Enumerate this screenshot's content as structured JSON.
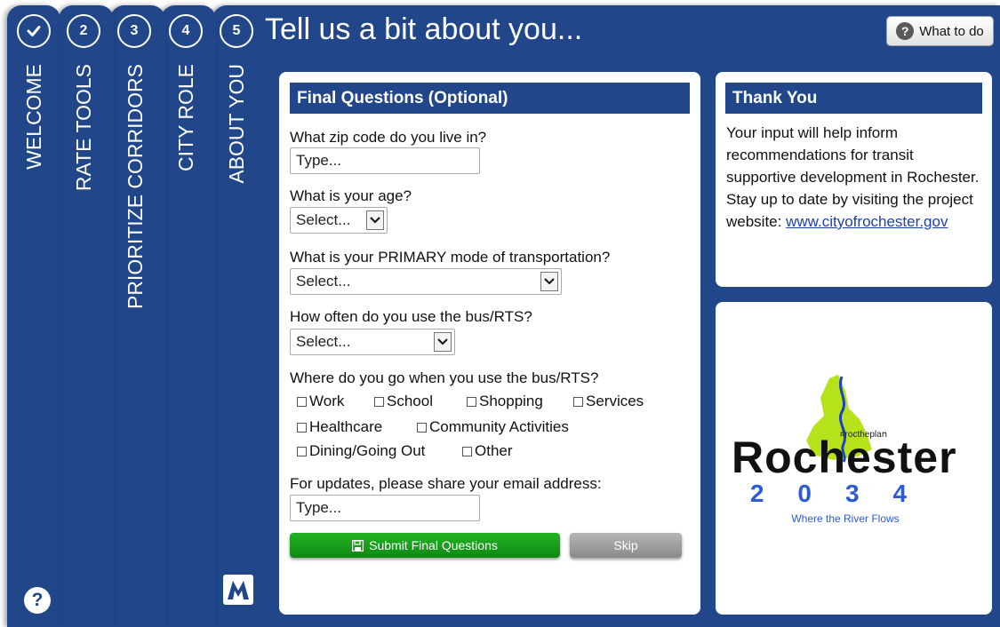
{
  "steps": [
    {
      "badge": "✔",
      "label": "WELCOME"
    },
    {
      "badge": "2",
      "label": "RATE TOOLS"
    },
    {
      "badge": "3",
      "label": "PRIORITIZE CORRIDORS"
    },
    {
      "badge": "4",
      "label": "CITY ROLE"
    },
    {
      "badge": "5",
      "label": "ABOUT YOU"
    }
  ],
  "header": {
    "title": "Tell us a bit about you...",
    "help_button": "What to do"
  },
  "colors": {
    "nav_blue": "#21468a",
    "submit_green": "#1a9e1c",
    "skip_gray": "#9a9a9a"
  },
  "form": {
    "title": "Final Questions (Optional)",
    "zip_label": "What zip code do you live in?",
    "zip_placeholder": "Type...",
    "age_label": "What is your age?",
    "age_value": "Select...",
    "mode_label": "What is your PRIMARY mode of transportation?",
    "mode_value": "Select...",
    "freq_label": "How often do you use the bus/RTS?",
    "freq_value": "Select...",
    "where_label": "Where do you go when you use the bus/RTS?",
    "options": [
      "Work",
      "School",
      "Shopping",
      "Services",
      "Healthcare",
      "Community Activities",
      "Dining/Going Out",
      "Other"
    ],
    "email_label": "For updates, please share your email address:",
    "email_placeholder": "Type...",
    "submit_label": "Submit Final Questions",
    "skip_label": "Skip"
  },
  "thanks": {
    "title": "Thank You",
    "text": "Your input will help inform recommendations for transit supportive development in Rochester. Stay up to date by visiting the project website:",
    "link": "www.cityofrochester.gov"
  },
  "logo": {
    "hashtag": "#roctheplaո",
    "name": "Rochester",
    "year": "2034",
    "tagline": "Where the River Flows"
  },
  "icons": {
    "help": "question-circle-icon",
    "brand": "brand-m-icon",
    "save": "floppy-icon"
  }
}
